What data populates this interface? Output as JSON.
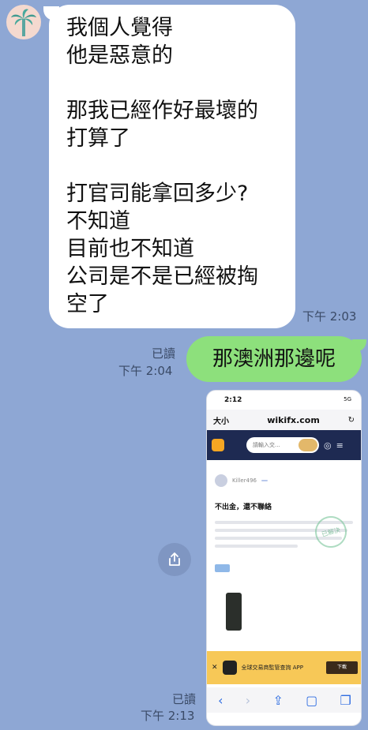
{
  "incoming": {
    "lines": [
      "我個人覺得",
      "他是惡意的",
      "",
      "那我已經作好最壞的",
      "打算了",
      "",
      "打官司能拿回多少?",
      "不知道",
      "目前也不知道",
      "公司是不是已經被掏",
      "空了"
    ],
    "time": "下午 2:03"
  },
  "outgoing": {
    "text": "那澳洲那邊呢",
    "read": "已讀",
    "time": "下午 2:04"
  },
  "image_message": {
    "read": "已讀",
    "time": "下午 2:13",
    "screenshot": {
      "status_time": "2:12",
      "network": "5G",
      "text_size": "大小",
      "url": "wikifx.com",
      "search_placeholder": "請輸入交...",
      "user": "Killer496",
      "post_title": "不出金，還不聯絡",
      "stamp": "已解決",
      "ad_text": "全球交易商監管查詢 APP",
      "ad_button": "下載"
    }
  }
}
